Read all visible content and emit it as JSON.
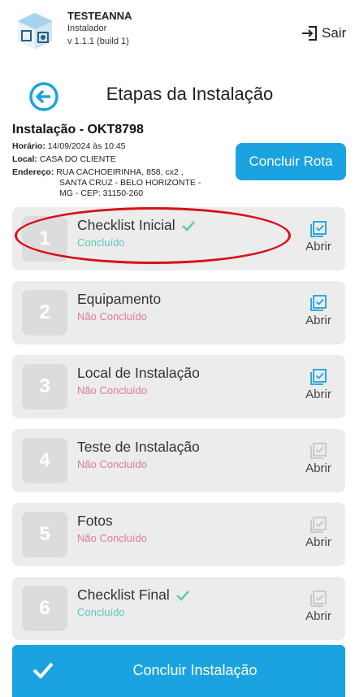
{
  "header": {
    "app_name": "TESTEANNA",
    "role": "Instalador",
    "version": "v 1.1.1 (build 1)",
    "logout_label": "Sair"
  },
  "page": {
    "title": "Etapas da Instalação"
  },
  "installation": {
    "title": "Instalação - OKT8798",
    "horario_label": "Horário:",
    "horario_value": "14/09/2024 às 10:45",
    "local_label": "Local:",
    "local_value": "CASA DO CLIENTE",
    "endereco_label": "Endereço:",
    "endereco_line1": "RUA CACHOEIRINHA, 858, cx2 ,",
    "endereco_line2": "SANTA CRUZ  -  BELO HORIZONTE  -",
    "endereco_line3": "MG  -  CEP: 31150-260"
  },
  "route_button": "Concluir Rota",
  "steps": [
    {
      "number": "1",
      "title": "Checklist Inicial",
      "status": "Concluído",
      "done": true,
      "open_label": "Abrir",
      "open_enabled": true
    },
    {
      "number": "2",
      "title": "Equipamento",
      "status": "Não Concluído",
      "done": false,
      "open_label": "Abrir",
      "open_enabled": true
    },
    {
      "number": "3",
      "title": "Local de Instalação",
      "status": "Não Concluído",
      "done": false,
      "open_label": "Abrir",
      "open_enabled": true
    },
    {
      "number": "4",
      "title": "Teste de Instalação",
      "status": "Não Concluído",
      "done": false,
      "open_label": "Abrir",
      "open_enabled": false
    },
    {
      "number": "5",
      "title": "Fotos",
      "status": "Não Concluído",
      "done": false,
      "open_label": "Abrir",
      "open_enabled": false
    },
    {
      "number": "6",
      "title": "Checklist Final",
      "status": "Concluído",
      "done": true,
      "open_label": "Abrir",
      "open_enabled": false
    }
  ],
  "bottom_button": "Concluir Instalação",
  "colors": {
    "accent": "#1aa3e0",
    "done": "#5cc9b8",
    "pending": "#e07a9a",
    "highlight": "#d8101b"
  }
}
